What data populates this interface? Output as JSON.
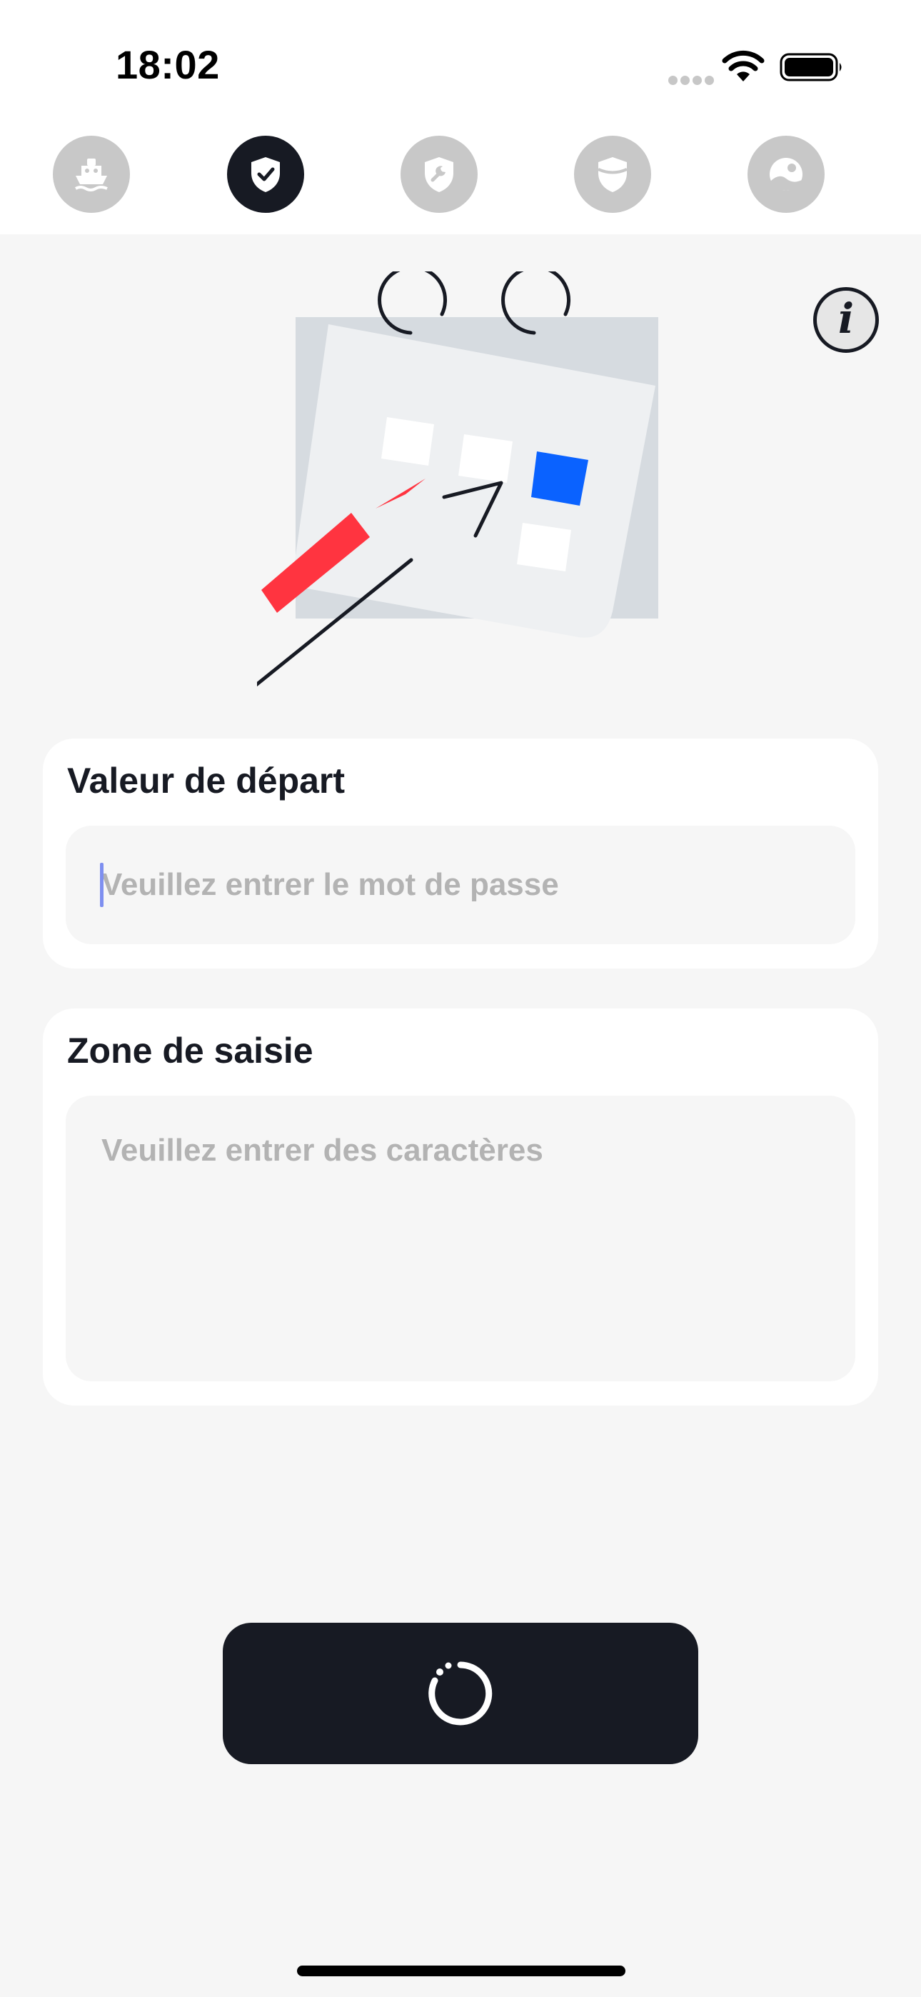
{
  "status_bar": {
    "time": "18:02",
    "icons": [
      "cellular-signal-icon",
      "wifi-icon",
      "battery-icon"
    ]
  },
  "tabs": [
    {
      "icon": "ship-icon",
      "active": false
    },
    {
      "icon": "shield-check-icon",
      "active": true
    },
    {
      "icon": "shield-wrench-icon",
      "active": false
    },
    {
      "icon": "shield-half-icon",
      "active": false
    },
    {
      "icon": "landscape-photo-icon",
      "active": false
    }
  ],
  "info_button": {
    "icon": "info-icon",
    "glyph": "i"
  },
  "illustration": {
    "icon": "calendar-pencil-illustration"
  },
  "start_value": {
    "title": "Valeur de départ",
    "placeholder": "Veuillez entrer le mot de passe",
    "value": ""
  },
  "input_zone": {
    "title": "Zone de saisie",
    "placeholder": "Veuillez entrer des caractères",
    "value": ""
  },
  "action_button": {
    "icon": "loading-spinner-icon"
  },
  "colors": {
    "accent_dark": "#171a23",
    "background": "#f6f6f6",
    "tab_inactive": "#c8c8c8",
    "illustration_red": "#ff3440",
    "illustration_blue": "#0a62ff",
    "caret": "#7e8ff0"
  }
}
